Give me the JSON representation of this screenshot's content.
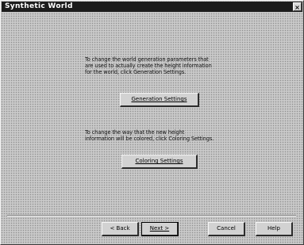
{
  "window": {
    "title": "Synthetic World",
    "close_glyph": "×"
  },
  "generation": {
    "lines": [
      "To change the world generation parameters that",
      "are used to actually create the height information",
      "for the world, click Generation Settings."
    ],
    "button_label": "Generation Settings"
  },
  "coloring": {
    "lines": [
      "To change the way that the new height",
      "information will be colored, click Coloring Settings."
    ],
    "button_label": "Coloring Settings"
  },
  "footer": {
    "back_label": "< Back",
    "next_label": "Next >",
    "cancel_label": "Cancel",
    "help_label": "Help"
  }
}
